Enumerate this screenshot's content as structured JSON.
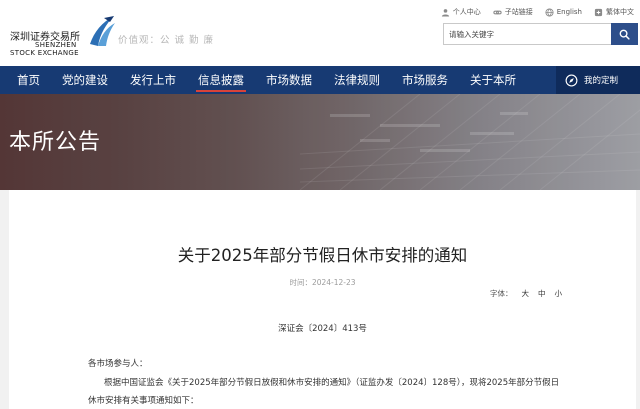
{
  "header": {
    "logo_cn": "深圳证券交易所",
    "logo_en_line1": "SHENZHEN",
    "logo_en_line2": "STOCK EXCHANGE",
    "values_slogan": "价值观：公 诚 勤 廉",
    "links": [
      {
        "label": "个人中心",
        "icon": "user-icon"
      },
      {
        "label": "子站链接",
        "icon": "link-icon"
      },
      {
        "label": "English",
        "icon": "globe-icon"
      },
      {
        "label": "繁体中文",
        "icon": "traditional-chinese-icon"
      }
    ],
    "search": {
      "placeholder": "请输入关键字",
      "icon": "search-icon"
    }
  },
  "nav": {
    "items": [
      {
        "label": "首页"
      },
      {
        "label": "党的建设"
      },
      {
        "label": "发行上市"
      },
      {
        "label": "信息披露",
        "active": true
      },
      {
        "label": "市场数据"
      },
      {
        "label": "法律规则"
      },
      {
        "label": "市场服务"
      },
      {
        "label": "关于本所"
      }
    ],
    "my_custom": {
      "label": "我的定制",
      "icon": "compass-icon"
    }
  },
  "banner": {
    "title": "本所公告"
  },
  "article": {
    "title": "关于2025年部分节假日休市安排的通知",
    "time_label": "时间：",
    "time_value": "2024-12-23",
    "font_size_label": "字体：",
    "font_sizes": [
      "大",
      "中",
      "小"
    ],
    "doc_number": "深证会〔2024〕413号",
    "paragraphs": [
      "各市场参与人：",
      "根据中国证监会《关于2025年部分节假日放假和休市安排的通知》（证监办发〔2024〕128号），现将2025年部分节假日",
      "休市安排有关事项通知如下："
    ]
  },
  "colors": {
    "nav_bg": "#173a73",
    "nav_active_underline": "#d7423a",
    "search_button": "#2d4e8a",
    "my_custom_bg": "#0f2b5b",
    "logo_mark_blue": "#2c6fb5"
  }
}
